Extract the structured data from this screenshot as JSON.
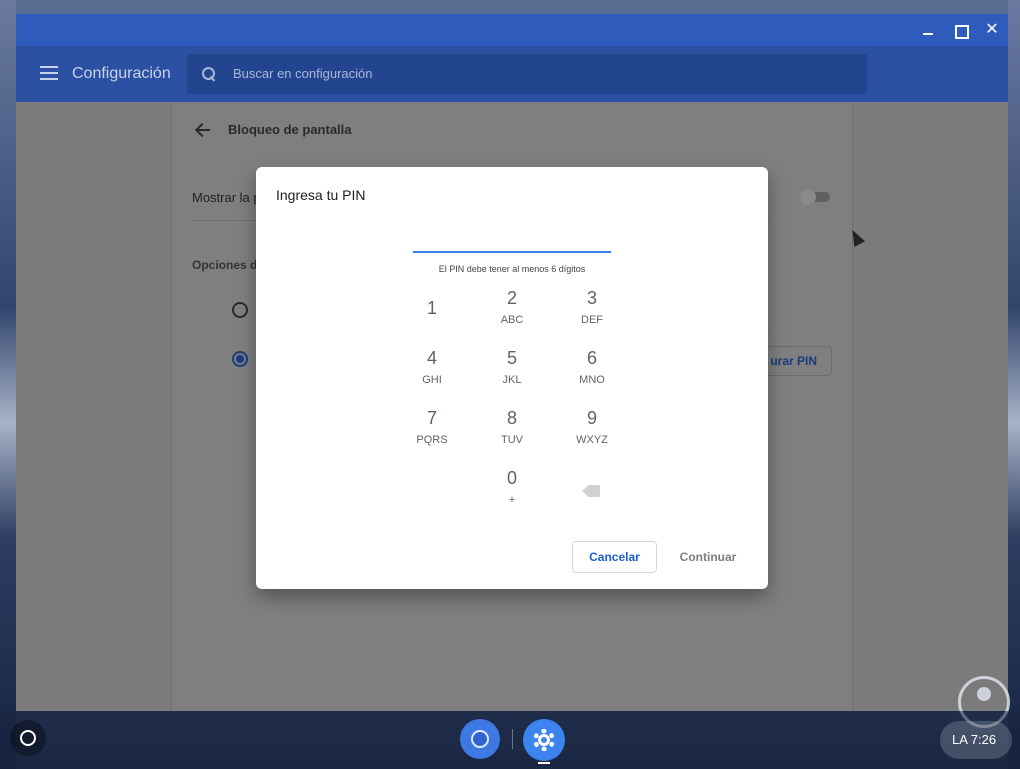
{
  "window": {
    "app_title": "Configuración",
    "search_placeholder": "Buscar en configuración"
  },
  "page": {
    "section_title": "Bloqueo de pantalla",
    "show_row_label": "Mostrar la p",
    "options_label": "Opciones d",
    "config_pin_button": "urar PIN"
  },
  "dialog": {
    "title": "Ingresa tu PIN",
    "pin_value": "",
    "hint": "El PIN debe tener al menos 6 dígitos",
    "keys": [
      {
        "digit": "1",
        "letters": ""
      },
      {
        "digit": "2",
        "letters": "ABC"
      },
      {
        "digit": "3",
        "letters": "DEF"
      },
      {
        "digit": "4",
        "letters": "GHI"
      },
      {
        "digit": "5",
        "letters": "JKL"
      },
      {
        "digit": "6",
        "letters": "MNO"
      },
      {
        "digit": "7",
        "letters": "PQRS"
      },
      {
        "digit": "8",
        "letters": "TUV"
      },
      {
        "digit": "9",
        "letters": "WXYZ"
      },
      {
        "digit": "0",
        "letters": "+"
      }
    ],
    "cancel_label": "Cancelar",
    "continue_label": "Continuar"
  },
  "shelf": {
    "status_text": "LA  7:26"
  },
  "colors": {
    "titlebar": "#2f5bbd",
    "appbar": "#2c50a2",
    "accent": "#3b7de9",
    "button_text": "#1a5fcc"
  },
  "icons": [
    "menu-icon",
    "search-icon",
    "back-arrow-icon",
    "backspace-icon",
    "chrome-icon",
    "settings-icon",
    "launcher-icon"
  ]
}
